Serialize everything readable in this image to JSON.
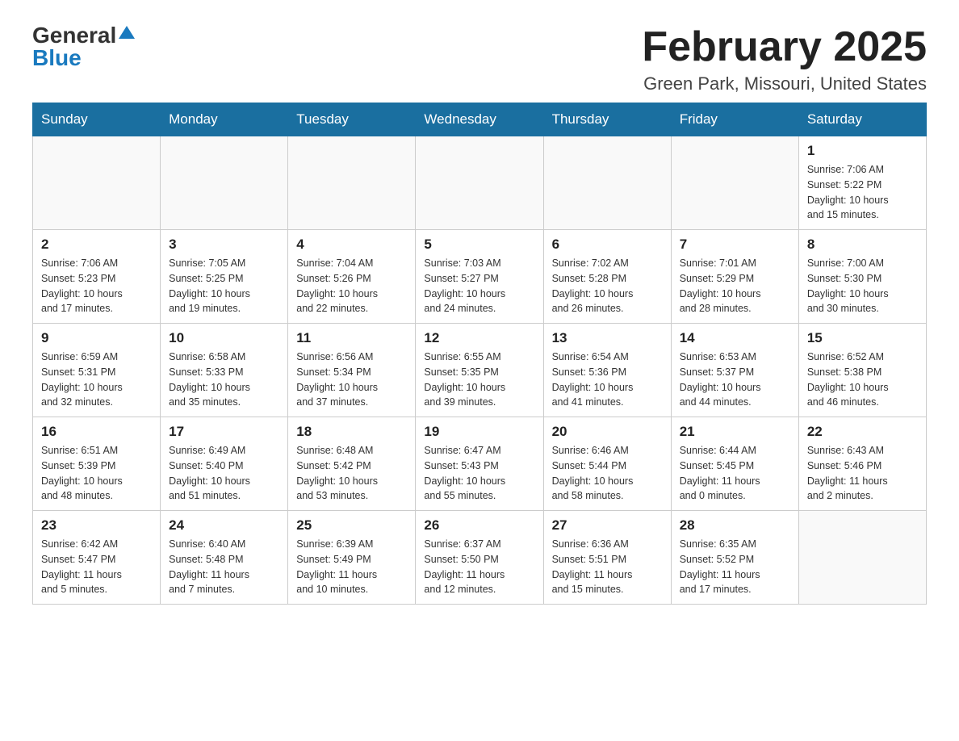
{
  "logo": {
    "general": "General",
    "blue": "Blue"
  },
  "title": "February 2025",
  "subtitle": "Green Park, Missouri, United States",
  "weekdays": [
    "Sunday",
    "Monday",
    "Tuesday",
    "Wednesday",
    "Thursday",
    "Friday",
    "Saturday"
  ],
  "weeks": [
    [
      {
        "day": "",
        "info": ""
      },
      {
        "day": "",
        "info": ""
      },
      {
        "day": "",
        "info": ""
      },
      {
        "day": "",
        "info": ""
      },
      {
        "day": "",
        "info": ""
      },
      {
        "day": "",
        "info": ""
      },
      {
        "day": "1",
        "info": "Sunrise: 7:06 AM\nSunset: 5:22 PM\nDaylight: 10 hours\nand 15 minutes."
      }
    ],
    [
      {
        "day": "2",
        "info": "Sunrise: 7:06 AM\nSunset: 5:23 PM\nDaylight: 10 hours\nand 17 minutes."
      },
      {
        "day": "3",
        "info": "Sunrise: 7:05 AM\nSunset: 5:25 PM\nDaylight: 10 hours\nand 19 minutes."
      },
      {
        "day": "4",
        "info": "Sunrise: 7:04 AM\nSunset: 5:26 PM\nDaylight: 10 hours\nand 22 minutes."
      },
      {
        "day": "5",
        "info": "Sunrise: 7:03 AM\nSunset: 5:27 PM\nDaylight: 10 hours\nand 24 minutes."
      },
      {
        "day": "6",
        "info": "Sunrise: 7:02 AM\nSunset: 5:28 PM\nDaylight: 10 hours\nand 26 minutes."
      },
      {
        "day": "7",
        "info": "Sunrise: 7:01 AM\nSunset: 5:29 PM\nDaylight: 10 hours\nand 28 minutes."
      },
      {
        "day": "8",
        "info": "Sunrise: 7:00 AM\nSunset: 5:30 PM\nDaylight: 10 hours\nand 30 minutes."
      }
    ],
    [
      {
        "day": "9",
        "info": "Sunrise: 6:59 AM\nSunset: 5:31 PM\nDaylight: 10 hours\nand 32 minutes."
      },
      {
        "day": "10",
        "info": "Sunrise: 6:58 AM\nSunset: 5:33 PM\nDaylight: 10 hours\nand 35 minutes."
      },
      {
        "day": "11",
        "info": "Sunrise: 6:56 AM\nSunset: 5:34 PM\nDaylight: 10 hours\nand 37 minutes."
      },
      {
        "day": "12",
        "info": "Sunrise: 6:55 AM\nSunset: 5:35 PM\nDaylight: 10 hours\nand 39 minutes."
      },
      {
        "day": "13",
        "info": "Sunrise: 6:54 AM\nSunset: 5:36 PM\nDaylight: 10 hours\nand 41 minutes."
      },
      {
        "day": "14",
        "info": "Sunrise: 6:53 AM\nSunset: 5:37 PM\nDaylight: 10 hours\nand 44 minutes."
      },
      {
        "day": "15",
        "info": "Sunrise: 6:52 AM\nSunset: 5:38 PM\nDaylight: 10 hours\nand 46 minutes."
      }
    ],
    [
      {
        "day": "16",
        "info": "Sunrise: 6:51 AM\nSunset: 5:39 PM\nDaylight: 10 hours\nand 48 minutes."
      },
      {
        "day": "17",
        "info": "Sunrise: 6:49 AM\nSunset: 5:40 PM\nDaylight: 10 hours\nand 51 minutes."
      },
      {
        "day": "18",
        "info": "Sunrise: 6:48 AM\nSunset: 5:42 PM\nDaylight: 10 hours\nand 53 minutes."
      },
      {
        "day": "19",
        "info": "Sunrise: 6:47 AM\nSunset: 5:43 PM\nDaylight: 10 hours\nand 55 minutes."
      },
      {
        "day": "20",
        "info": "Sunrise: 6:46 AM\nSunset: 5:44 PM\nDaylight: 10 hours\nand 58 minutes."
      },
      {
        "day": "21",
        "info": "Sunrise: 6:44 AM\nSunset: 5:45 PM\nDaylight: 11 hours\nand 0 minutes."
      },
      {
        "day": "22",
        "info": "Sunrise: 6:43 AM\nSunset: 5:46 PM\nDaylight: 11 hours\nand 2 minutes."
      }
    ],
    [
      {
        "day": "23",
        "info": "Sunrise: 6:42 AM\nSunset: 5:47 PM\nDaylight: 11 hours\nand 5 minutes."
      },
      {
        "day": "24",
        "info": "Sunrise: 6:40 AM\nSunset: 5:48 PM\nDaylight: 11 hours\nand 7 minutes."
      },
      {
        "day": "25",
        "info": "Sunrise: 6:39 AM\nSunset: 5:49 PM\nDaylight: 11 hours\nand 10 minutes."
      },
      {
        "day": "26",
        "info": "Sunrise: 6:37 AM\nSunset: 5:50 PM\nDaylight: 11 hours\nand 12 minutes."
      },
      {
        "day": "27",
        "info": "Sunrise: 6:36 AM\nSunset: 5:51 PM\nDaylight: 11 hours\nand 15 minutes."
      },
      {
        "day": "28",
        "info": "Sunrise: 6:35 AM\nSunset: 5:52 PM\nDaylight: 11 hours\nand 17 minutes."
      },
      {
        "day": "",
        "info": ""
      }
    ]
  ]
}
